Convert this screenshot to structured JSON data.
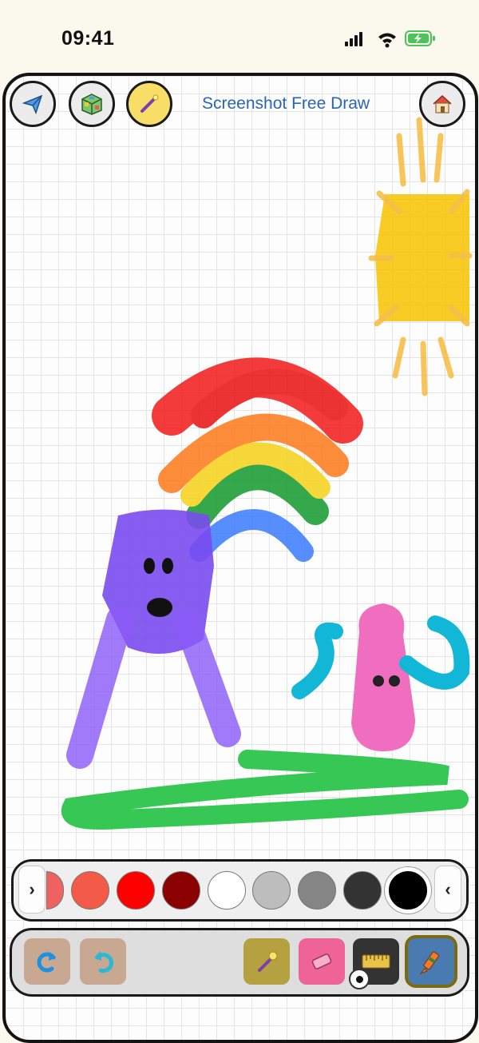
{
  "status_bar": {
    "time": "09:41"
  },
  "header": {
    "title": "Screenshot Free Draw",
    "buttons": [
      "share-icon",
      "puzzle-cube-icon",
      "magic-wand-icon",
      "home-icon"
    ],
    "active_button_color": "#f8de66"
  },
  "palette": {
    "prev_label": "›",
    "next_label": "‹",
    "colors": [
      "#ef6262",
      "#f35a47",
      "#ff0000",
      "#8b0000",
      "#ffffff",
      "#bdbdbd",
      "#858585",
      "#333333",
      "#000000"
    ],
    "selected_color": "#000000"
  },
  "toolbar": {
    "tools": [
      "redo-icon",
      "undo-icon",
      "magic-wand-tool-icon",
      "eraser-icon",
      "brush-size-ruler-icon",
      "crayon-icon"
    ],
    "selected_tool": "crayon-icon"
  }
}
